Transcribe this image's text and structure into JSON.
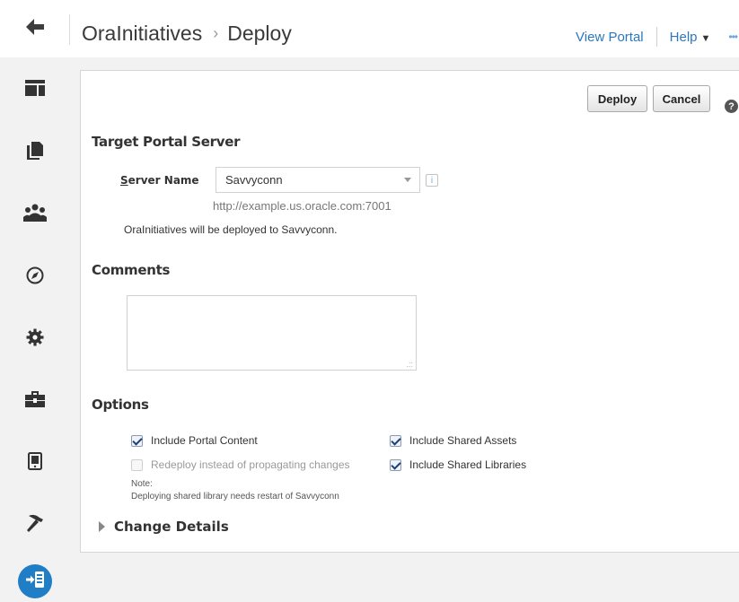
{
  "header": {
    "back_icon": "arrow-left-icon",
    "breadcrumb": {
      "portal": "OraInitiatives",
      "separator": "›",
      "page": "Deploy"
    },
    "view_portal": "View Portal",
    "help": "Help",
    "help_caret": "▼",
    "more": "•••"
  },
  "sidebar": {
    "items": [
      {
        "icon": "layout-icon"
      },
      {
        "icon": "pages-icon"
      },
      {
        "icon": "people-icon"
      },
      {
        "icon": "compass-icon"
      },
      {
        "icon": "settings-icon"
      },
      {
        "icon": "toolbox-icon"
      },
      {
        "icon": "device-icon"
      },
      {
        "icon": "hammer-icon"
      },
      {
        "icon": "deploy-icon",
        "active": true
      }
    ],
    "active_color": "#1f7ec5"
  },
  "toolbar": {
    "deploy_label": "Deploy",
    "cancel_label": "Cancel",
    "help_icon": "?"
  },
  "target": {
    "section_title": "Target Portal Server",
    "server_label_key": "S",
    "server_label_rest": "erver Name",
    "server_value": "Savvyconn",
    "server_url": "http://example.us.oracle.com:7001",
    "deploy_message": "OraInitiatives will be deployed to Savvyconn."
  },
  "comments": {
    "section_title": "Comments",
    "value": ""
  },
  "options": {
    "section_title": "Options",
    "include_portal_content": {
      "label": "Include Portal Content",
      "checked": true
    },
    "redeploy": {
      "label": "Redeploy instead of propagating changes",
      "checked": false,
      "disabled": true
    },
    "include_shared_assets": {
      "label": "Include Shared Assets",
      "checked": true
    },
    "include_shared_libraries": {
      "label": "Include Shared Libraries",
      "checked": true
    },
    "note_label": "Note:",
    "note_text": "Deploying shared library needs restart of Savvyconn"
  },
  "change_details": {
    "label": "Change Details"
  },
  "colors": {
    "link": "#2c77bd",
    "accent": "#1f7ec5"
  }
}
